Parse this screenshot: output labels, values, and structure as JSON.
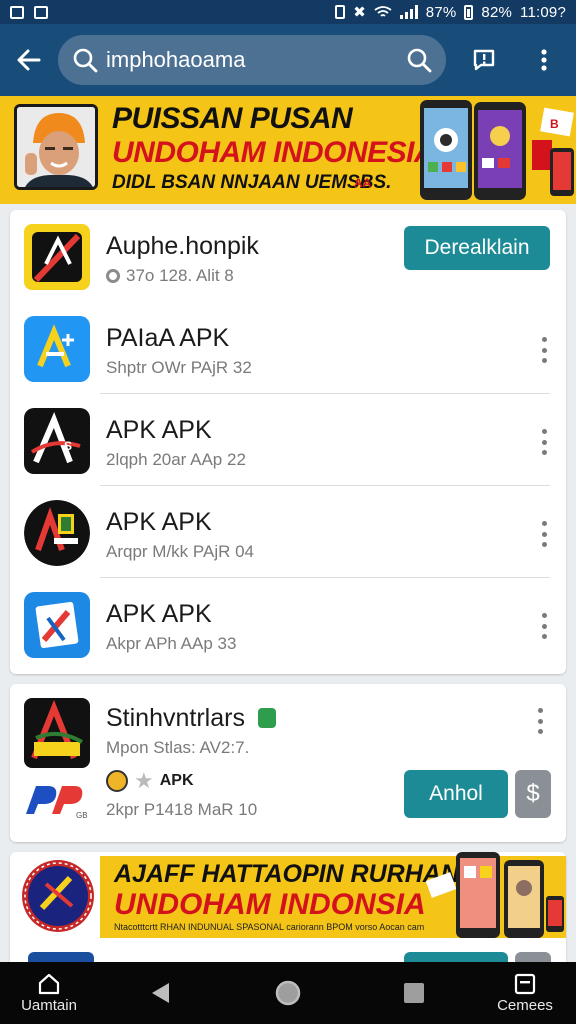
{
  "status_bar": {
    "battery_a": "87%",
    "battery_b": "82%",
    "time": "11:09?"
  },
  "search": {
    "query": "imphohaoama"
  },
  "banner_top": {
    "line1": "PUISSAN PUSAN",
    "line2": "UNDOHAM INDONESIA",
    "line3": "DIDL BSAN NNJAAN UEMSBS.",
    "badge": "AA"
  },
  "featured": {
    "title": "Auphe.honpik",
    "meta": "37o 128. Alit 8",
    "button_label": "Derealklain"
  },
  "apps": [
    {
      "title": "PAIaA APK",
      "meta": "Shptr OWr PAjR 32"
    },
    {
      "title": "APK APK",
      "meta": "2lqph 20ar AAp 22"
    },
    {
      "title": "APK APK",
      "meta": "Arqpr M/kk PAjR 04"
    },
    {
      "title": "APK APK",
      "meta": "Akpr APh AAp 33"
    }
  ],
  "card2": {
    "title": "Stinhvntrlars",
    "meta": "Mpon Stlas: AV2:7.",
    "tag": "APK",
    "meta2": "2kpr P1418 MaR 10",
    "button_label": "Anhol",
    "side_button_label": "$"
  },
  "banner_bottom": {
    "line1": "AJAFF HATTAOPIN RURHAN",
    "line2": "UNDOHAM INDONSIA",
    "line3": "Ntacotttcrtt RHAN INDUNUAL SPASONAL cariorann BPOM vorso Aocan cam"
  },
  "nav": {
    "left_label": "Uamtain",
    "right_label": "Cemees"
  },
  "colors": {
    "status": "#123a63",
    "appbar": "#184c79",
    "accent": "#1d8b96",
    "banner": "#f4c417"
  }
}
